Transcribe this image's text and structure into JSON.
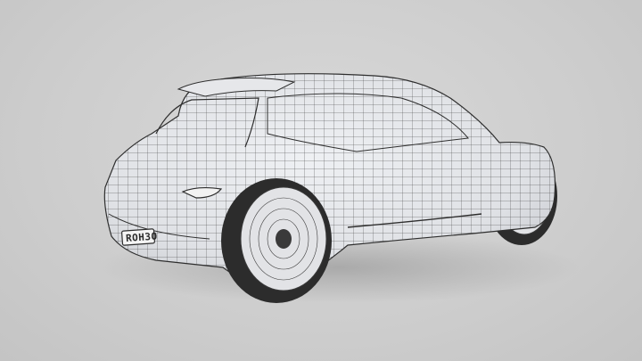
{
  "scene": {
    "subject": "car-wireframe-render",
    "license_plate": "ROH3O",
    "colors": {
      "background": "#cfcfcf",
      "body": "#e6e7ea",
      "wire": "#3a3a3a",
      "tire": "#2c2c2c",
      "rim": "#e2e3e6"
    }
  }
}
